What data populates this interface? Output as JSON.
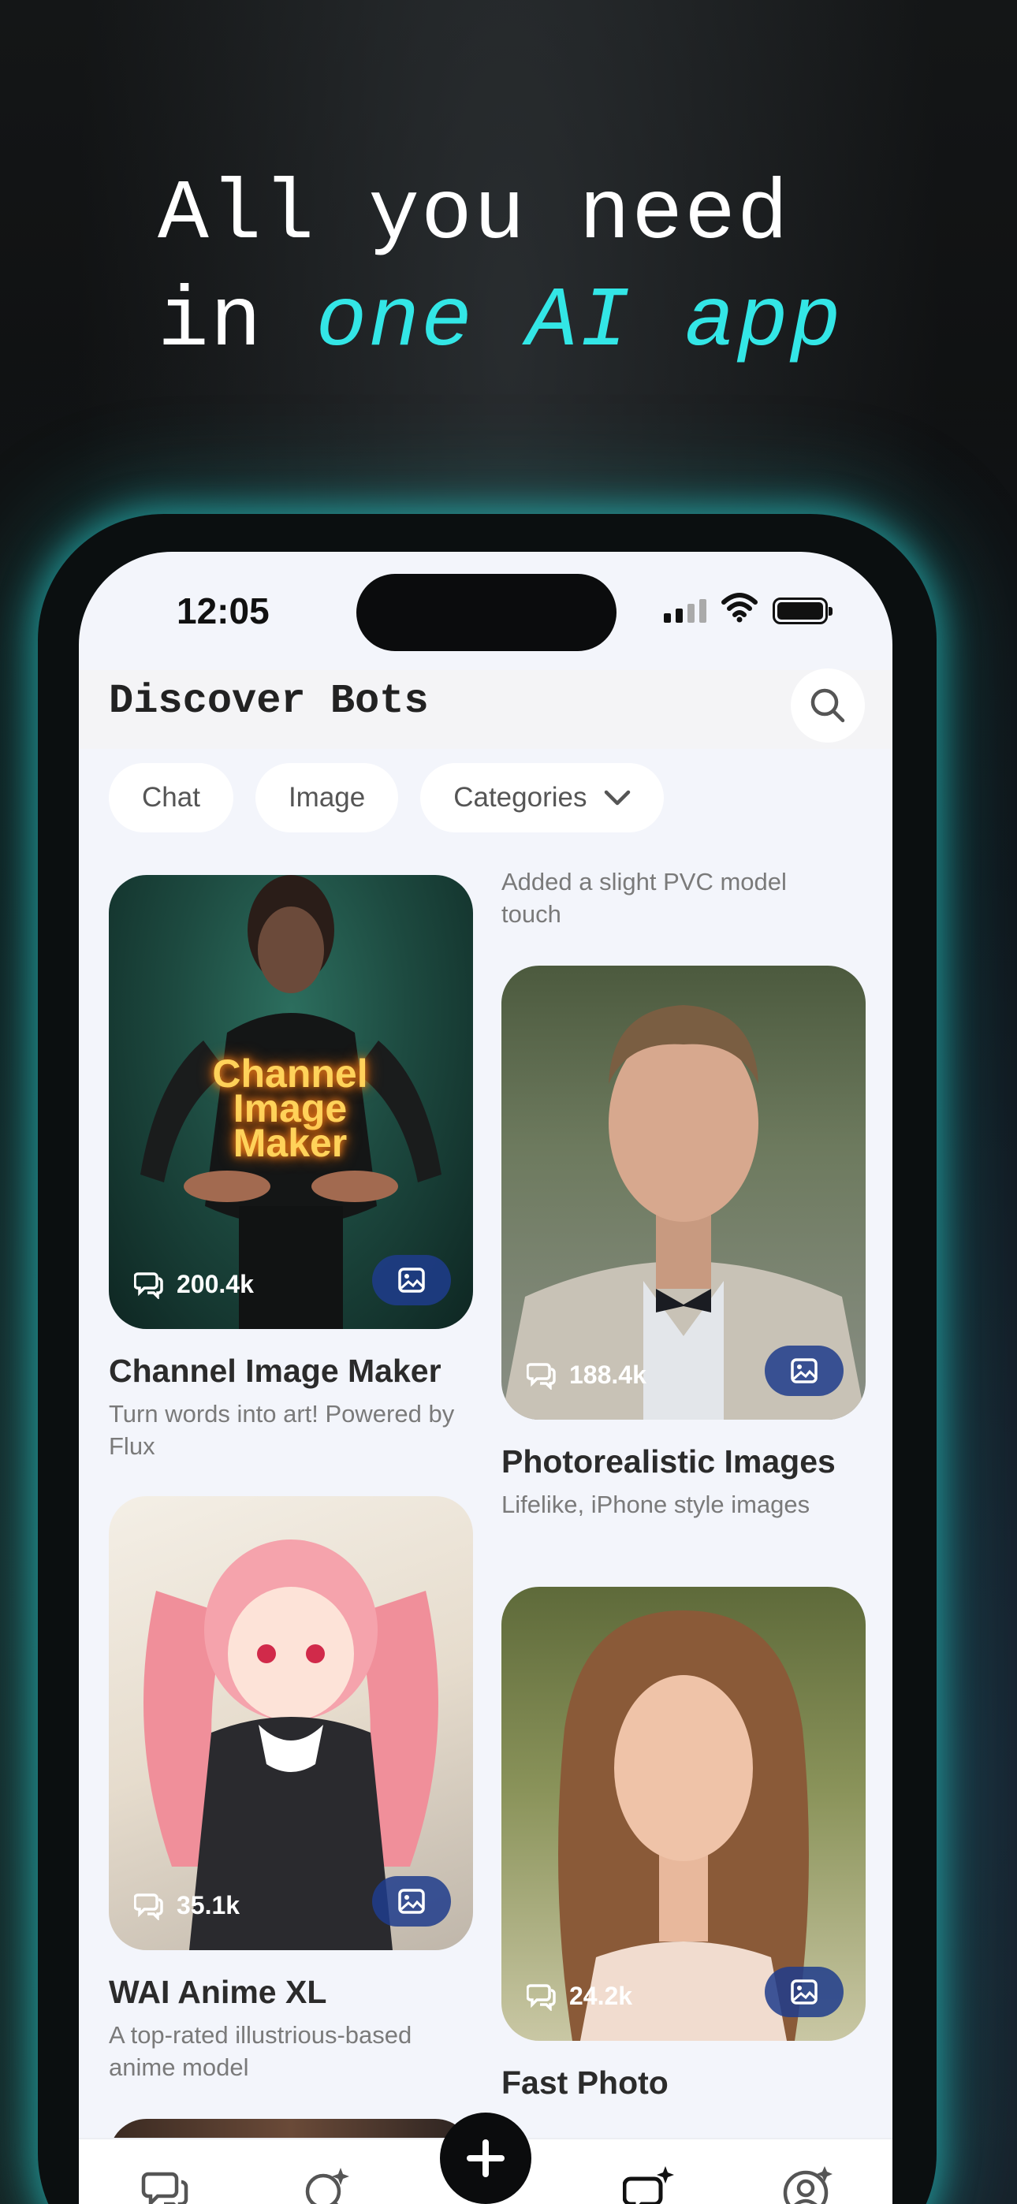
{
  "promo": {
    "line1": "All you need",
    "line2_prefix": "in ",
    "line2_accent": "one AI app"
  },
  "status_bar": {
    "time": "12:05"
  },
  "header": {
    "title": "Discover Bots"
  },
  "filters": [
    {
      "label": "Chat"
    },
    {
      "label": "Image"
    },
    {
      "label": "Categories"
    }
  ],
  "top_note": "Added a slight PVC model touch",
  "bots": [
    {
      "name": "Channel Image Maker",
      "desc": "Turn words into art! Powered by Flux",
      "count": "200.4k",
      "image_text": "Channel Image Maker"
    },
    {
      "name": "Photorealistic Images",
      "desc": "Lifelike, iPhone style images",
      "count": "188.4k"
    },
    {
      "name": "WAI Anime XL",
      "desc": "A top-rated illustrious-based anime model",
      "count": "35.1k"
    },
    {
      "name": "Fast Photo",
      "desc": "",
      "count": "24.2k"
    }
  ],
  "icons": {
    "search": "search-icon",
    "chevron": "chevron-down-icon",
    "chat": "chat-bubbles-icon",
    "image": "image-icon",
    "add": "plus-icon",
    "discover": "discover-icon",
    "bots": "bot-sparkle-icon",
    "profile": "profile-sparkle-icon"
  },
  "colors": {
    "accent": "#33e6e6",
    "badge": "#1e3c8c"
  }
}
